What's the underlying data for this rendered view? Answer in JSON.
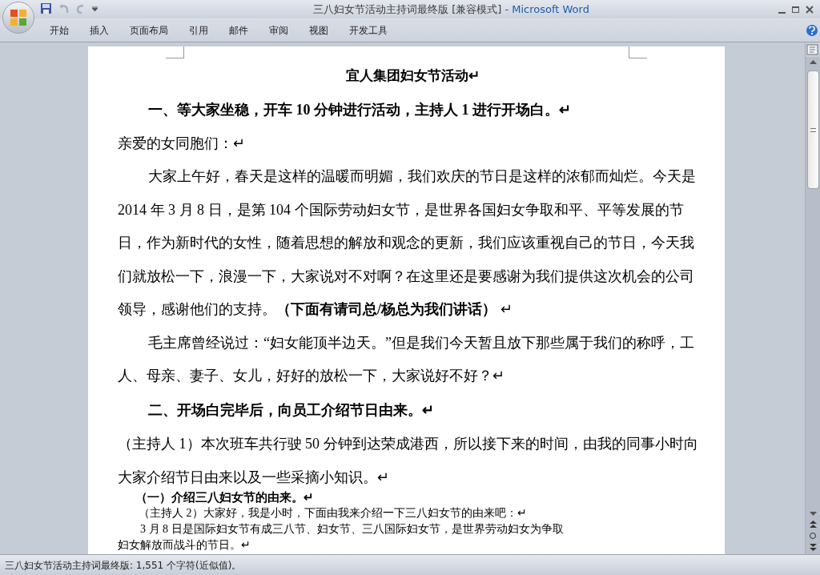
{
  "window": {
    "title": "三八妇女节活动主持词最终版 [兼容模式]",
    "app": "- Microsoft Word"
  },
  "ribbon_tabs": [
    {
      "label": "开始"
    },
    {
      "label": "插入"
    },
    {
      "label": "页面布局"
    },
    {
      "label": "引用"
    },
    {
      "label": "邮件"
    },
    {
      "label": "审阅"
    },
    {
      "label": "视图"
    },
    {
      "label": "开发工具"
    }
  ],
  "document": {
    "paragraphs": [
      {
        "kind": "title",
        "text": "宜人集团妇女节活动↵"
      },
      {
        "kind": "heading",
        "text": "一、等大家坐稳，开车 10 分钟进行活动，主持人 1 进行开场白。↵"
      },
      {
        "kind": "plain",
        "text": "亲爱的女同胞们：↵"
      },
      {
        "kind": "body",
        "text": "大家上午好，春天是这样的温暖而明媚，我们欢庆的节日是这样的浓郁而灿烂。今天是 2014 年 3 月 8 日，是第 104 个国际劳动妇女节，是世界各国妇女争取和平、平等发展的节日，作为新时代的女性，随着思想的解放和观念的更新，我们应该重视自己的节日，今天我们就放松一下，浪漫一下，大家说对不对啊？在这里还是要感谢为我们提供这次机会的公司领导，感谢他们的支持。**（下面有请司总/杨总为我们讲话）** ↵"
      },
      {
        "kind": "body",
        "text": "毛主席曾经说过：“妇女能顶半边天。”但是我们今天暂且放下那些属于我们的称呼，工人、母亲、妻子、女儿，好好的放松一下，大家说好不好？↵"
      },
      {
        "kind": "heading",
        "text": "二、开场白完毕后，向员工介绍节日由来。↵"
      },
      {
        "kind": "plain",
        "text": "（主持人 1）本次班车共行驶 50 分钟到达荣成港西，所以接下来的时间，由我的同事小时向大家介绍节日由来以及一些采摘小知识。↵"
      },
      {
        "kind": "small_heading",
        "text": "（一）介绍三八妇女节的由来。↵"
      },
      {
        "kind": "small_note",
        "text": "（主持人 2）大家好，我是小时，下面由我来介绍一下三八妇女节的由来吧：↵"
      },
      {
        "kind": "small_body",
        "text": "3 月 8 日是国际妇女节有成三八节、妇女节、三八国际妇女节，是世界劳动妇女为争取"
      },
      {
        "kind": "small_plain",
        "text": "妇女解放而战斗的节日。↵"
      }
    ]
  },
  "status_bar": {
    "text": "三八妇女节活动主持词最终版: 1,551 个字符(近似值)。"
  }
}
